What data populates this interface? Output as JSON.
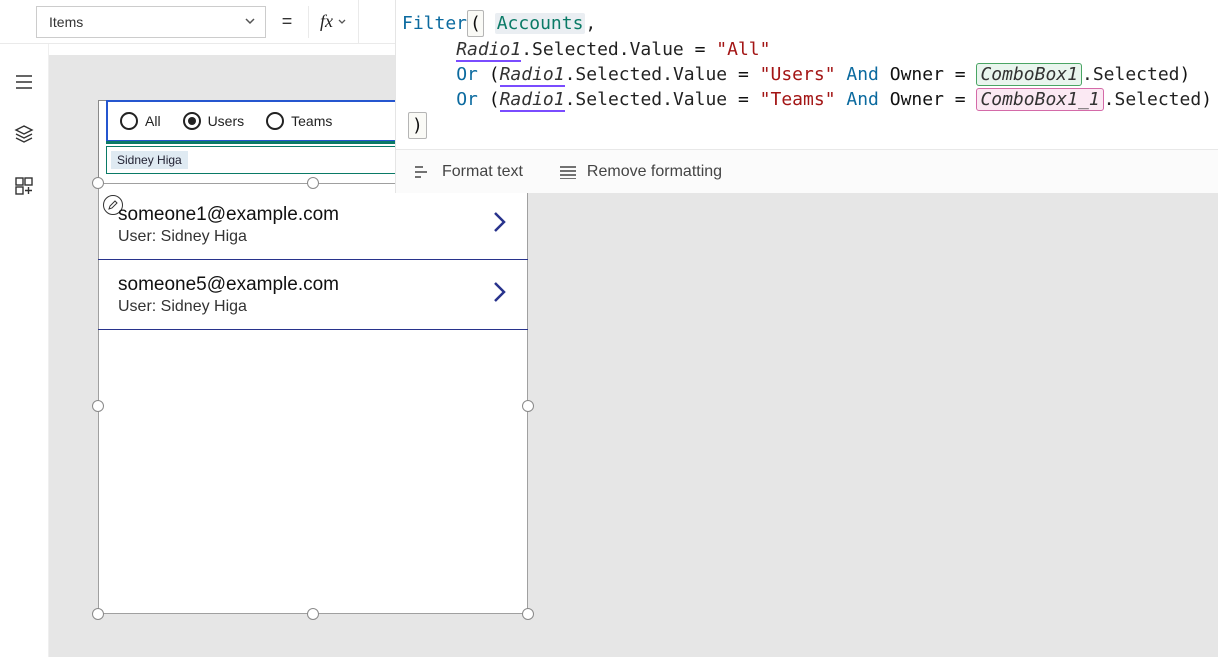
{
  "property_selector": {
    "value": "Items"
  },
  "equals": "=",
  "fx_label": "fx",
  "formula": {
    "fn": "Filter",
    "source": "Accounts",
    "radio_ref": "Radio1",
    "sel_path": ".Selected.Value",
    "eq": " = ",
    "val_all": "\"All\"",
    "or": "Or",
    "and": "And",
    "owner": "Owner",
    "val_users": "\"Users\"",
    "val_teams": "\"Teams\"",
    "combo1": "ComboBox1",
    "combo2": "ComboBox1_1",
    "selected": ".Selected"
  },
  "toolbar": {
    "format": "Format text",
    "remove": "Remove formatting"
  },
  "radio": {
    "opt_all": "All",
    "opt_users": "Users",
    "opt_teams": "Teams",
    "selected": "Users"
  },
  "combo_value": "Sidney Higa",
  "results": [
    {
      "email": "someone1@example.com",
      "owner": "User: Sidney Higa"
    },
    {
      "email": "someone5@example.com",
      "owner": "User: Sidney Higa"
    }
  ]
}
